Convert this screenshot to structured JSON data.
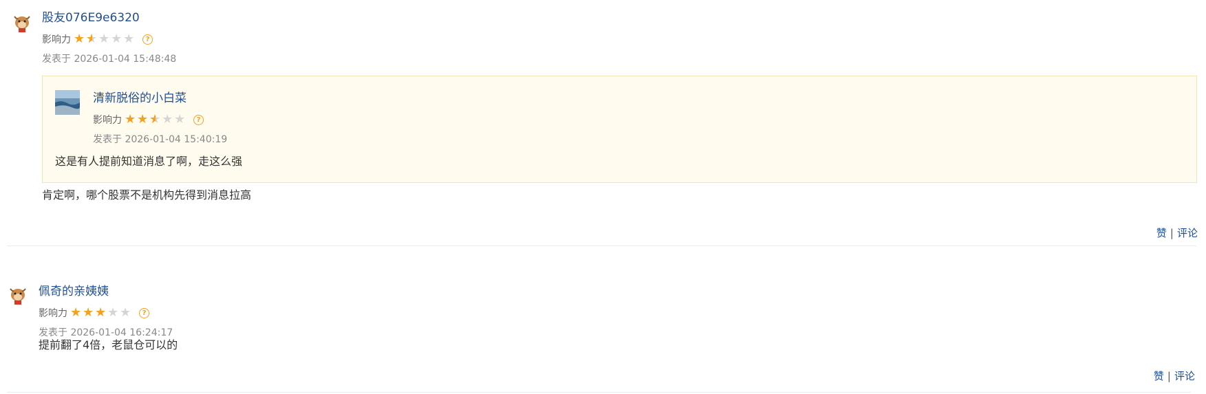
{
  "posts": [
    {
      "username": "股友076E9e6320",
      "influence_label": "影响力",
      "rating": 1.5,
      "time": "发表于 2026-01-04 15:48:48",
      "quote": {
        "username": "清新脱俗的小白菜",
        "influence_label": "影响力",
        "rating": 2.5,
        "time": "发表于 2026-01-04 15:40:19",
        "content": "这是有人提前知道消息了啊，走这么强"
      },
      "content": "肯定啊，哪个股票不是机构先得到消息拉高",
      "actions": {
        "like": "赞",
        "separator": "|",
        "comment": "评论"
      }
    },
    {
      "username": "佩奇的亲姨姨",
      "influence_label": "影响力",
      "rating": 3,
      "time": "发表于 2026-01-04 16:24:17",
      "content": "提前翻了4倍，老鼠仓可以的",
      "actions": {
        "like": "赞",
        "separator": "|",
        "comment": "评论"
      }
    }
  ],
  "colors": {
    "link": "#1f4e96",
    "star": "#f4a11c",
    "quote_bg": "#fffcef"
  },
  "icons": {
    "avatar": "cartoon-bull-avatar",
    "quote_avatar": "landscape-photo-avatar",
    "help": "question-circle-icon",
    "star": "star-icon"
  }
}
